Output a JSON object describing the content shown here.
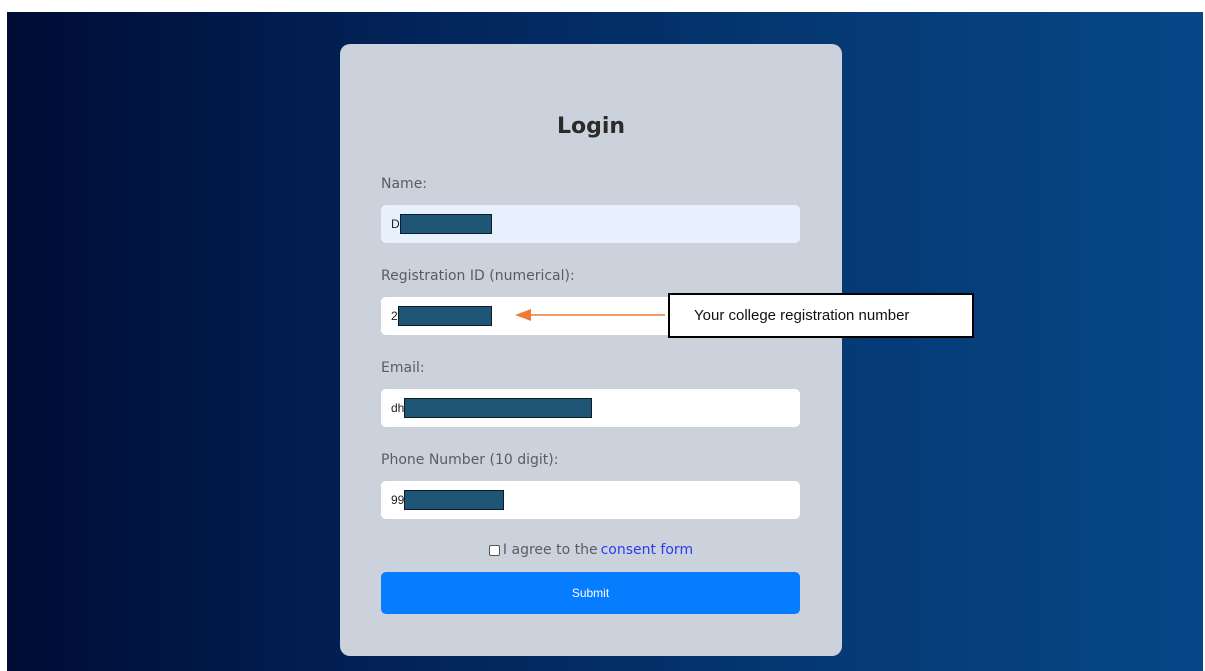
{
  "form": {
    "title": "Login",
    "name_label": "Name:",
    "name_value": "D",
    "regid_label": "Registration ID (numerical):",
    "regid_value": "2",
    "email_label": "Email:",
    "email_value": "dh",
    "phone_label": "Phone Number (10 digit):",
    "phone_value": "99",
    "consent_prefix": "I agree to the",
    "consent_link": "consent form",
    "submit_label": "Submit"
  },
  "annotation": {
    "callout_text": "Your college registration number"
  },
  "colors": {
    "background_left": "#000c35",
    "background_right": "#064787",
    "card": "#cbd2dc",
    "submit": "#057dfe",
    "link": "#2a3cf0",
    "redaction": "#1f5675",
    "arrow": "#ed7a36"
  }
}
